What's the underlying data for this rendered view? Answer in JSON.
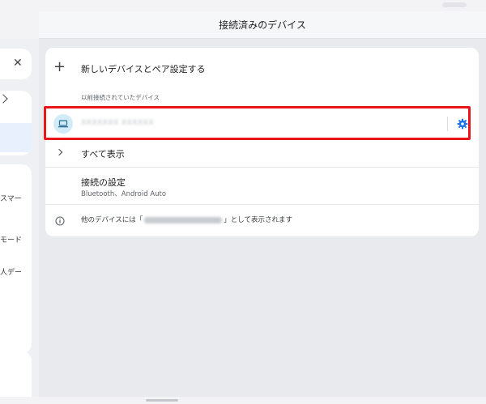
{
  "header": {
    "title": "接続済みのデバイス"
  },
  "left_pane": {
    "fragments": [
      "スマー",
      "モード",
      "人デー"
    ]
  },
  "pair_new": {
    "label": "新しいデバイスとペア設定する"
  },
  "previously_connected": {
    "label": "以前接続されていたデバイス"
  },
  "device": {
    "name": "XXXXXXX XXXXXX"
  },
  "see_all": {
    "label": "すべて表示"
  },
  "connection_prefs": {
    "title": "接続の設定",
    "subtitle": "Bluetooth、Android Auto"
  },
  "info": {
    "prefix": "他のデバイスには「",
    "suffix": "」として表示されます"
  },
  "colors": {
    "accent": "#1a73e8",
    "highlight": "#e8151b",
    "device_icon_bg": "#d2ecf7"
  }
}
